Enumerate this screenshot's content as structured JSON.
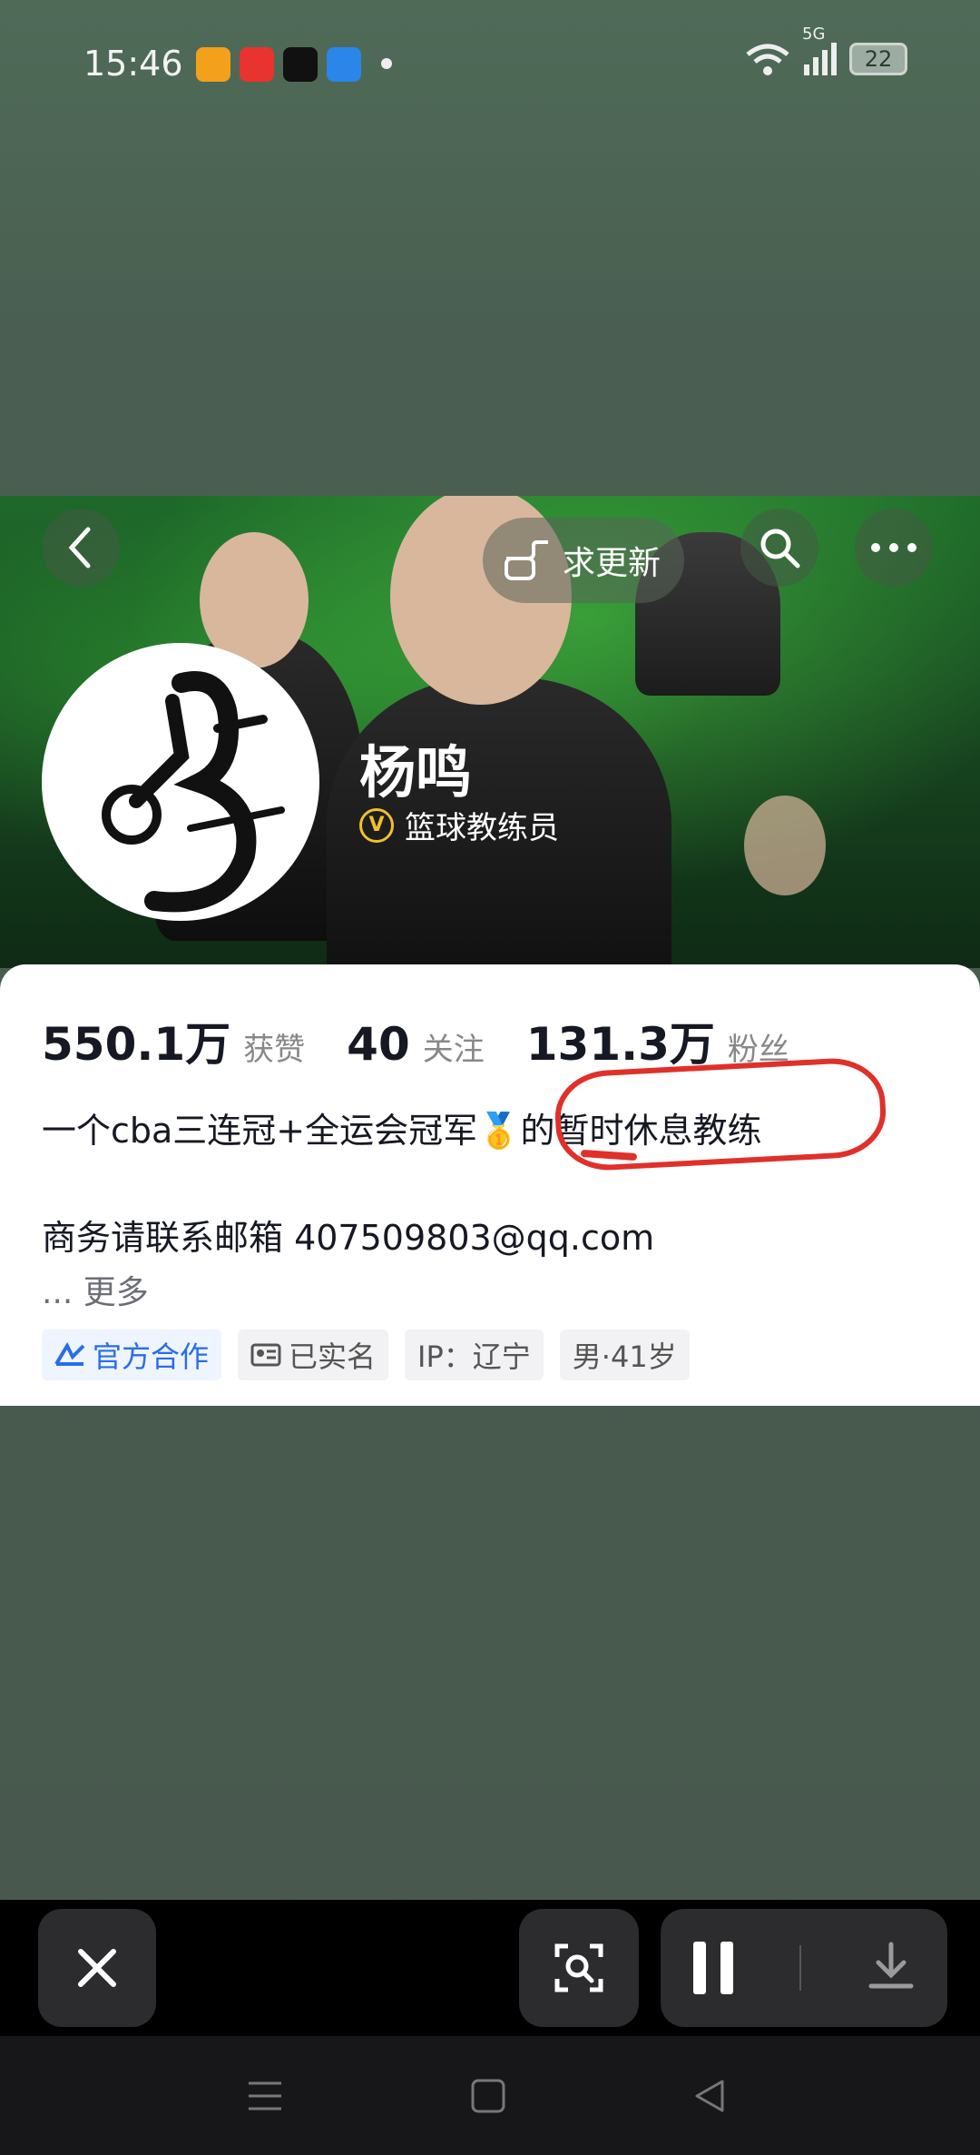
{
  "status_bar": {
    "time": "15:46",
    "network": "5G",
    "battery": "22"
  },
  "header": {
    "update_request_label": "求更新"
  },
  "profile": {
    "name": "杨鸣",
    "verified_title": "篮球教练员",
    "stats": {
      "likes_value": "550.1万",
      "likes_label": "获赞",
      "following_value": "40",
      "following_label": "关注",
      "followers_value": "131.3万",
      "followers_label": "粉丝"
    },
    "bio": "一个cba三连冠+全运会冠军🥇的暂时休息教练",
    "contact": "商务请联系邮箱  407509803@qq.com",
    "more_label": "... 更多",
    "tags": {
      "official": "官方合作",
      "verified": "已实名",
      "ip": "IP：辽宁",
      "gender_age": "男·41岁"
    }
  }
}
